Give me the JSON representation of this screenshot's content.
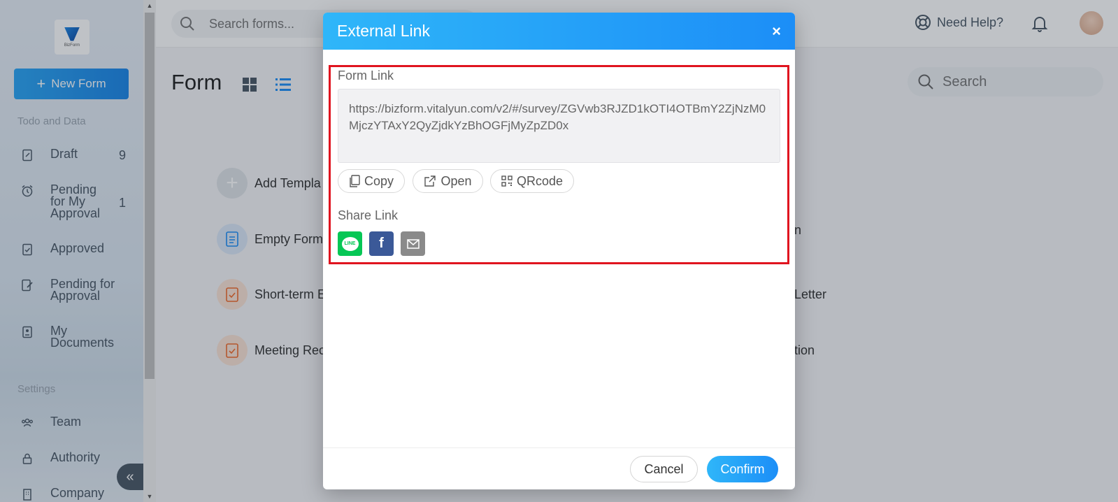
{
  "app": {
    "logo_text": "BizForm",
    "new_form_label": "New Form"
  },
  "sidebar": {
    "section_todo": "Todo and Data",
    "items": [
      {
        "label": "Draft",
        "count": "9",
        "icon": "draft-icon"
      },
      {
        "label": "Pending for My Approval",
        "count": "1",
        "icon": "alarm-icon"
      },
      {
        "label": "Approved",
        "count": "",
        "icon": "approved-icon"
      },
      {
        "label": "Pending for Approval",
        "count": "",
        "icon": "pending-edit-icon"
      },
      {
        "label": "My Documents",
        "count": "",
        "icon": "document-icon"
      }
    ],
    "section_settings": "Settings",
    "settings_items": [
      {
        "label": "Team",
        "icon": "team-icon"
      },
      {
        "label": "Authority",
        "icon": "lock-icon"
      },
      {
        "label": "Company",
        "icon": "building-icon"
      }
    ],
    "collapse_glyph": "«"
  },
  "header": {
    "search_placeholder": "Search forms...",
    "help_label": "Need Help?"
  },
  "main": {
    "title": "Form",
    "search_placeholder": "Search",
    "templates": [
      {
        "label": "Add Templa",
        "icon": "plus-icon"
      },
      {
        "label": "Empty Form",
        "icon": "document-icon"
      },
      {
        "label": "Short-term E",
        "icon": "checklist-icon"
      },
      {
        "label": "Meeting Rec",
        "icon": "checklist-icon"
      }
    ],
    "partial_right": [
      "n",
      "Letter",
      "tion"
    ]
  },
  "modal": {
    "title": "External Link",
    "close_glyph": "×",
    "form_link_label": "Form Link",
    "form_link_value": "https://bizform.vitalyun.com/v2/#/survey/ZGVwb3RJZD1kOTI4OTBmY2ZjNzM0MjczYTAxY2QyZjdkYzBhOGFjMyZpZD0x",
    "copy_label": "Copy",
    "open_label": "Open",
    "qrcode_label": "QRcode",
    "share_link_label": "Share Link",
    "share_line_text": "LINE",
    "share_facebook_glyph": "f",
    "cancel_label": "Cancel",
    "confirm_label": "Confirm"
  },
  "colors": {
    "accent": "#1c8ef7",
    "highlight": "#e0141f",
    "line": "#06c755",
    "facebook": "#3b5998",
    "mail": "#8a8a8a"
  }
}
